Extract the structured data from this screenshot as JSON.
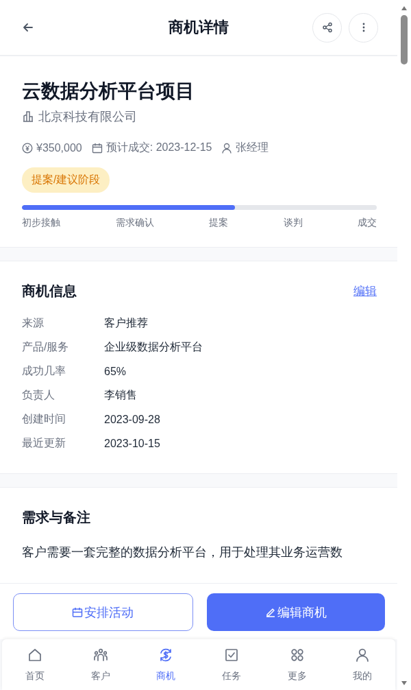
{
  "header": {
    "title": "商机详情"
  },
  "opportunity": {
    "name": "云数据分析平台项目",
    "company": "北京科技有限公司",
    "amount": "¥350,000",
    "expected_close": "预计成交: 2023-12-15",
    "owner": "张经理",
    "stage_badge": "提案/建议阶段",
    "progress": {
      "level": 0.6
    },
    "stages": [
      "初步接触",
      "需求确认",
      "提案",
      "谈判",
      "成交"
    ]
  },
  "info": {
    "title": "商机信息",
    "edit_link": "编辑",
    "fields": [
      {
        "label": "来源",
        "value": "客户推荐"
      },
      {
        "label": "产品/服务",
        "value": "企业级数据分析平台"
      },
      {
        "label": "成功几率",
        "value": "65%"
      },
      {
        "label": "负责人",
        "value": "李销售"
      },
      {
        "label": "创建时间",
        "value": "2023-09-28"
      },
      {
        "label": "最近更新",
        "value": "2023-10-15"
      }
    ]
  },
  "notes": {
    "title": "需求与备注",
    "text": "客户需要一套完整的数据分析平台，用于处理其业务运营数"
  },
  "actions": [
    {
      "kind": "outline",
      "label": "安排活动"
    },
    {
      "kind": "primary",
      "label": "编辑商机"
    }
  ],
  "nav": [
    {
      "kind": "home",
      "label": "首页",
      "selected": false
    },
    {
      "kind": "customers",
      "label": "客户",
      "selected": false
    },
    {
      "kind": "deals",
      "label": "商机",
      "selected": true
    },
    {
      "kind": "tasks",
      "label": "任务",
      "selected": false
    },
    {
      "kind": "more",
      "label": "更多",
      "selected": false
    },
    {
      "kind": "me",
      "label": "我的",
      "selected": false
    }
  ]
}
